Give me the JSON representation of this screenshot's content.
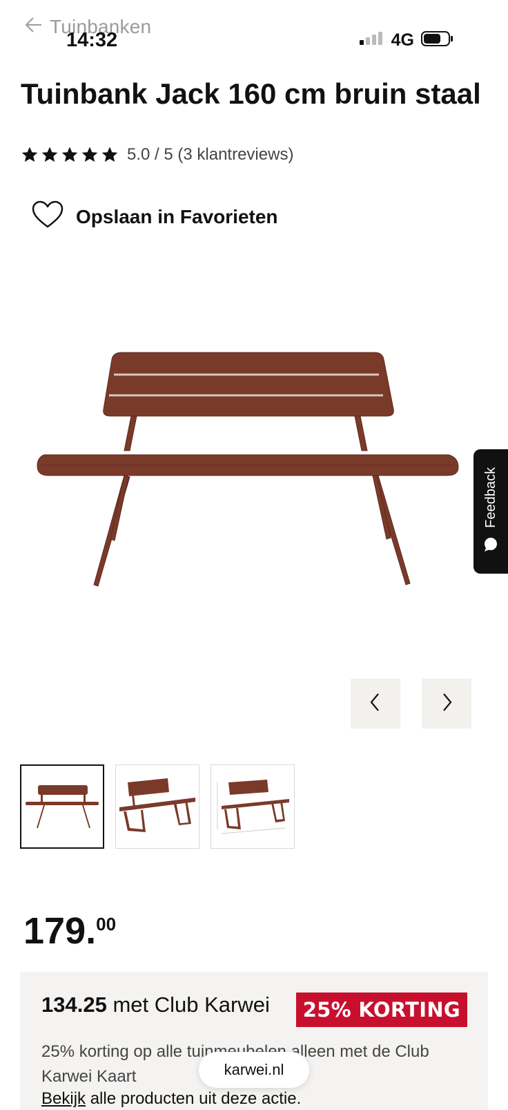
{
  "nav": {
    "back_label": "Tuinbanken"
  },
  "status_bar": {
    "time": "14:32",
    "network": "4G"
  },
  "product": {
    "title": "Tuinbank Jack 160 cm bruin staal",
    "rating_text": "5.0 / 5 (3 klantreviews)",
    "rating_value": 5.0,
    "rating_max": 5,
    "favorite_label": "Opslaan in Favorieten",
    "color_accent": "#7a3a2a"
  },
  "feedback": {
    "label": "Feedback"
  },
  "gallery": {
    "thumbnail_count": 3,
    "active_index": 0
  },
  "price": {
    "integer": "179.",
    "decimals": "00"
  },
  "club": {
    "price_value": "134.25",
    "price_label": " met Club Karwei",
    "badge": "25% KORTING",
    "badge_color": "#c8102e",
    "description": "25% korting op alle tuinmeubelen alleen met de Club Karwei Kaart",
    "link_prefix": "Bekijk",
    "link_rest": " alle producten uit deze actie."
  },
  "browser": {
    "url": "karwei.nl"
  }
}
